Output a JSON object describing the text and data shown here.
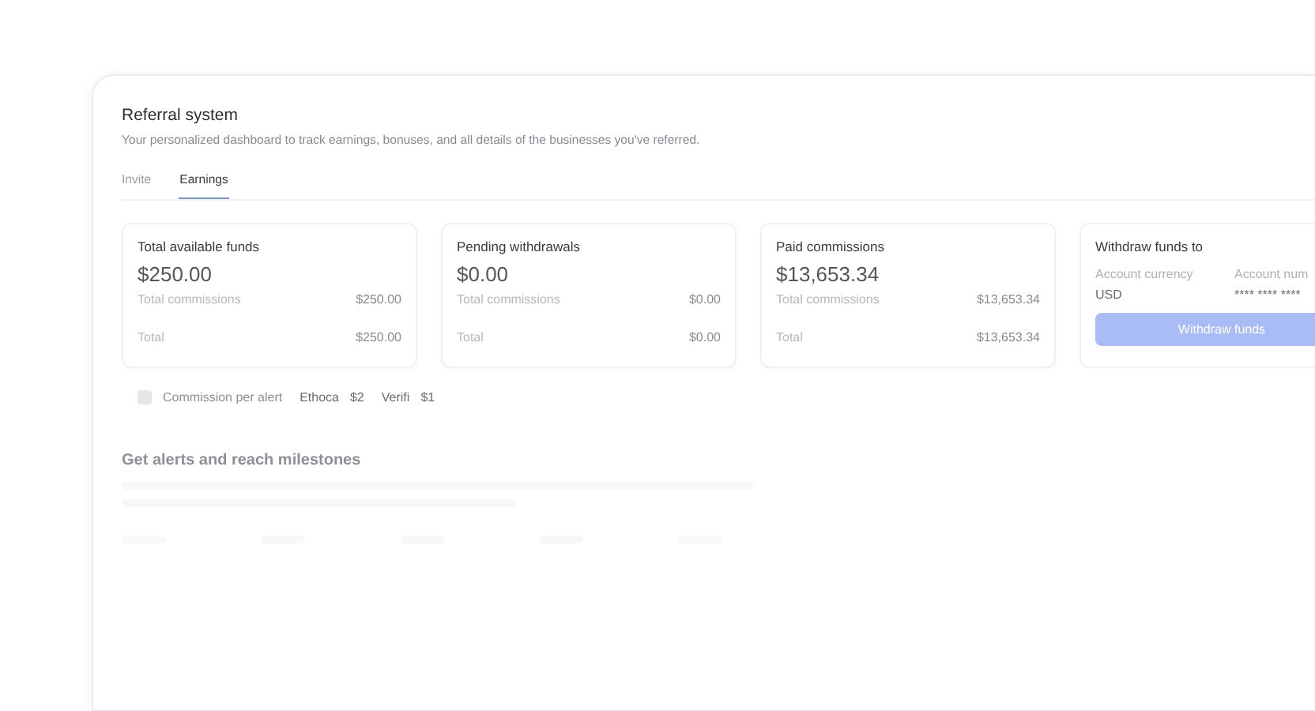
{
  "header": {
    "title": "Referral system",
    "subtitle": "Your personalized dashboard to track earnings, bonuses, and all details of the businesses you've referred."
  },
  "tabs": [
    {
      "label": "Invite",
      "selected": false
    },
    {
      "label": "Earnings",
      "selected": true
    }
  ],
  "stat_cards": [
    {
      "title": "Total available funds",
      "amount": "$250.00",
      "rows": [
        {
          "label": "Total commissions",
          "value": "$250.00"
        },
        {
          "label": "Total",
          "value": "$250.00"
        }
      ]
    },
    {
      "title": "Pending withdrawals",
      "amount": "$0.00",
      "rows": [
        {
          "label": "Total commissions",
          "value": "$0.00"
        },
        {
          "label": "Total",
          "value": "$0.00"
        }
      ]
    },
    {
      "title": "Paid commissions",
      "amount": "$13,653.34",
      "rows": [
        {
          "label": "Total commissions",
          "value": "$13,653.34"
        },
        {
          "label": "Total",
          "value": "$13,653.34"
        }
      ]
    }
  ],
  "withdraw_card": {
    "title": "Withdraw funds to",
    "fields": [
      {
        "label": "Account currency",
        "value": "USD"
      },
      {
        "label": "Account num",
        "value": "**** **** ****"
      }
    ],
    "button": {
      "label": "Withdraw funds",
      "disabled": true
    }
  },
  "commission_row": {
    "checked": false,
    "label": "Commission per alert",
    "items": [
      {
        "name": "Ethoca",
        "amount": "$2"
      },
      {
        "name": "Verifi",
        "amount": "$1"
      }
    ]
  },
  "milestones": {
    "title": "Get alerts and reach milestones"
  }
}
